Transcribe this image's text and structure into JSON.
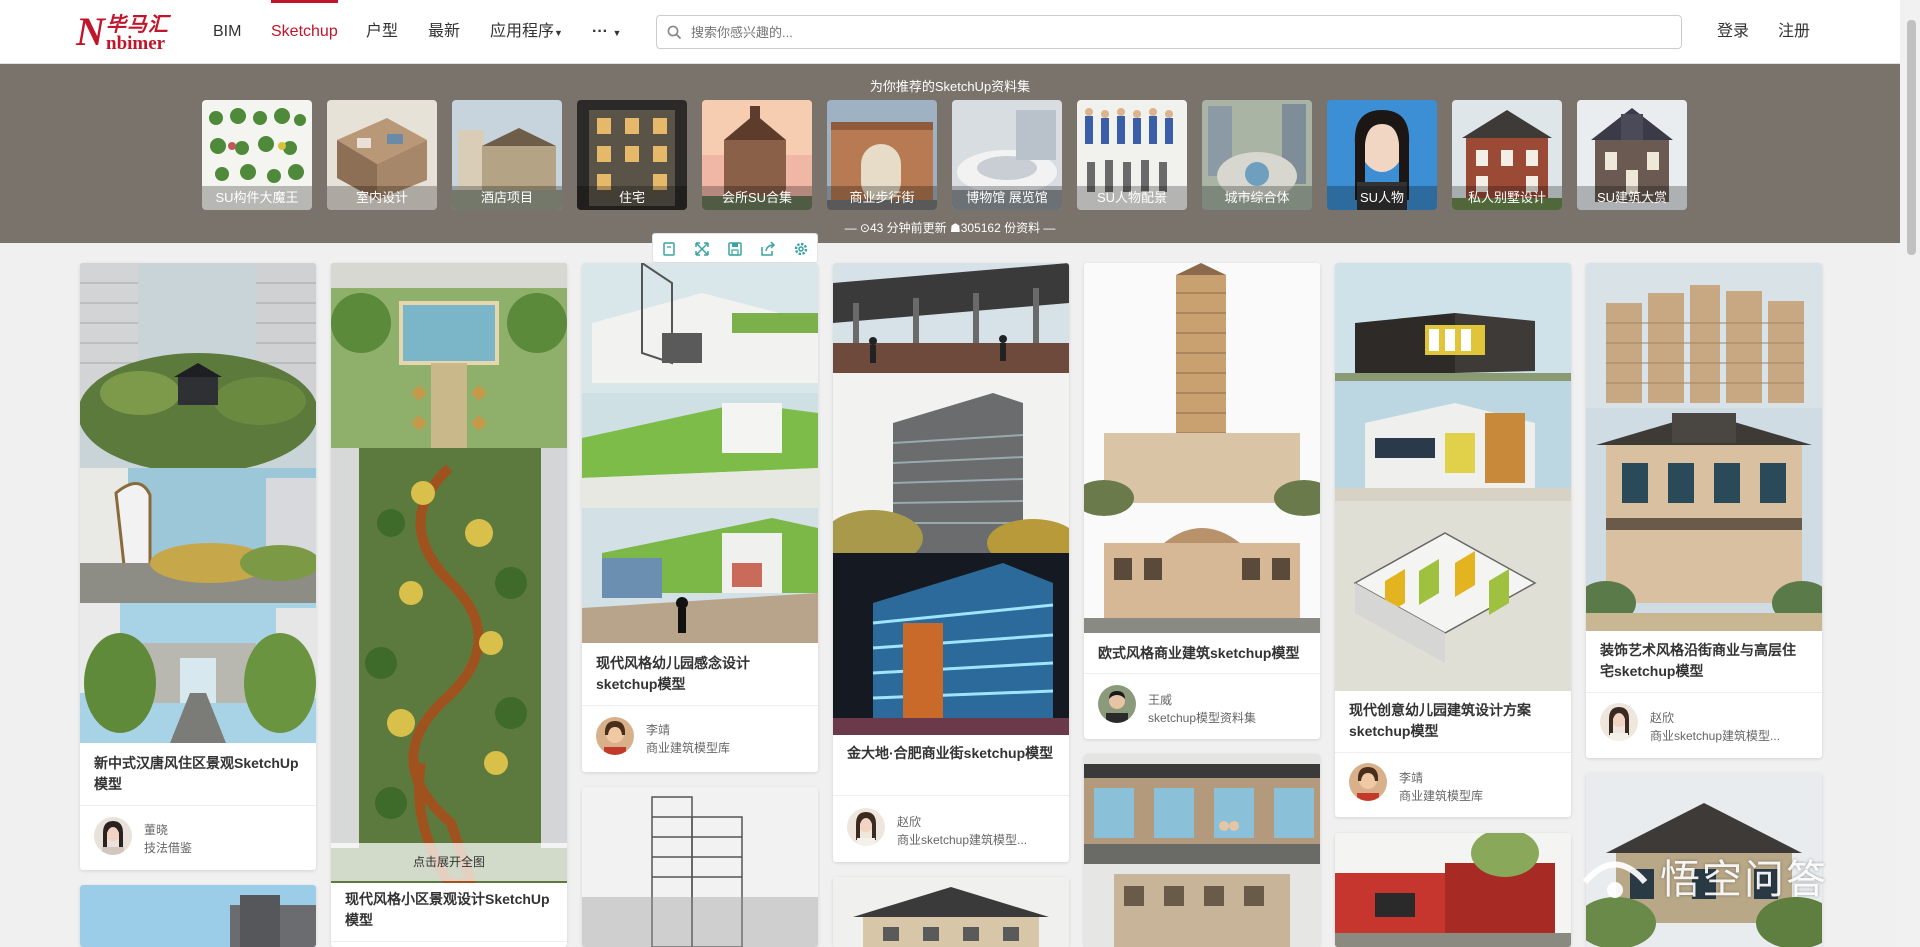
{
  "brand": {
    "logo_letter": "N",
    "logo_cn": "毕马汇",
    "logo_en": "nbimer"
  },
  "nav": {
    "items": [
      "BIM",
      "Sketchup",
      "户型",
      "最新",
      "应用程序",
      "···"
    ],
    "active": "Sketchup",
    "login": "登录",
    "register": "注册"
  },
  "search": {
    "placeholder": "搜索你感兴趣的..."
  },
  "recommend": {
    "title": "为你推荐的SketchUp资料集",
    "tiles": [
      "SU构件大魔王",
      "室内设计",
      "酒店项目",
      "住宅",
      "会所SU合集",
      "商业步行街",
      "博物馆 展览馆",
      "SU人物配景",
      "城市综合体",
      "SU人物",
      "私人别墅设计",
      "SU建筑大赏"
    ],
    "stats": "— ⊙43 分钟前更新     ☗305162 份资料 —"
  },
  "cards": [
    {
      "title": "新中式汉唐风住区景观SketchUp模型",
      "author": "董晓",
      "board": "技法借鉴"
    },
    {
      "title": "现代风格小区景观设计SketchUp模型",
      "expand": "点击展开全图"
    },
    {
      "title": "现代风格幼儿园感念设计sketchup模型",
      "author": "李靖",
      "board": "商业建筑模型库"
    },
    {
      "title": "金大地·合肥商业街sketchup模型",
      "author": "赵欣",
      "board": "商业sketchup建筑模型..."
    },
    {
      "title": "欧式风格商业建筑sketchup模型",
      "author": "王威",
      "board": "sketchup模型资料集"
    },
    {
      "title": "现代创意幼儿园建筑设计方案sketchup模型",
      "author": "李靖",
      "board": "商业建筑模型库"
    },
    {
      "title": "装饰艺术风格沿街商业与高层住宅sketchup模型",
      "author": "赵欣",
      "board": "商业sketchup建筑模型..."
    }
  ],
  "watermark": "悟空问答",
  "colors": {
    "brand_red": "#c0152a",
    "band": "#7a736b",
    "page_bg": "#f0f0f0"
  }
}
